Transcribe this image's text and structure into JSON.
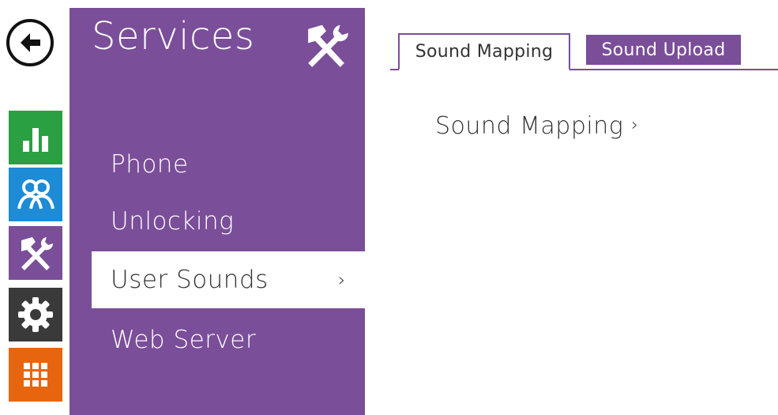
{
  "nav": {
    "title": "Services",
    "items": [
      {
        "label": "Phone"
      },
      {
        "label": "Unlocking"
      },
      {
        "label": "User Sounds",
        "chevron": "›"
      },
      {
        "label": "Web Server"
      }
    ]
  },
  "sidebar": {
    "back_icon": "back-arrow-icon",
    "icons": [
      "status-chart-icon",
      "users-icon",
      "services-tools-icon",
      "settings-gear-icon",
      "hardware-grid-icon"
    ],
    "colors": [
      "#2aa043",
      "#1d8bd6",
      "#7a4e99",
      "#3a3a3a",
      "#e8650f"
    ]
  },
  "tabs": [
    {
      "label": "Sound Mapping",
      "active": true
    },
    {
      "label": "Sound Upload",
      "active": false
    }
  ],
  "content": {
    "link_label": "Sound Mapping",
    "link_arrow": "›"
  },
  "accent_color": "#7a4e99"
}
